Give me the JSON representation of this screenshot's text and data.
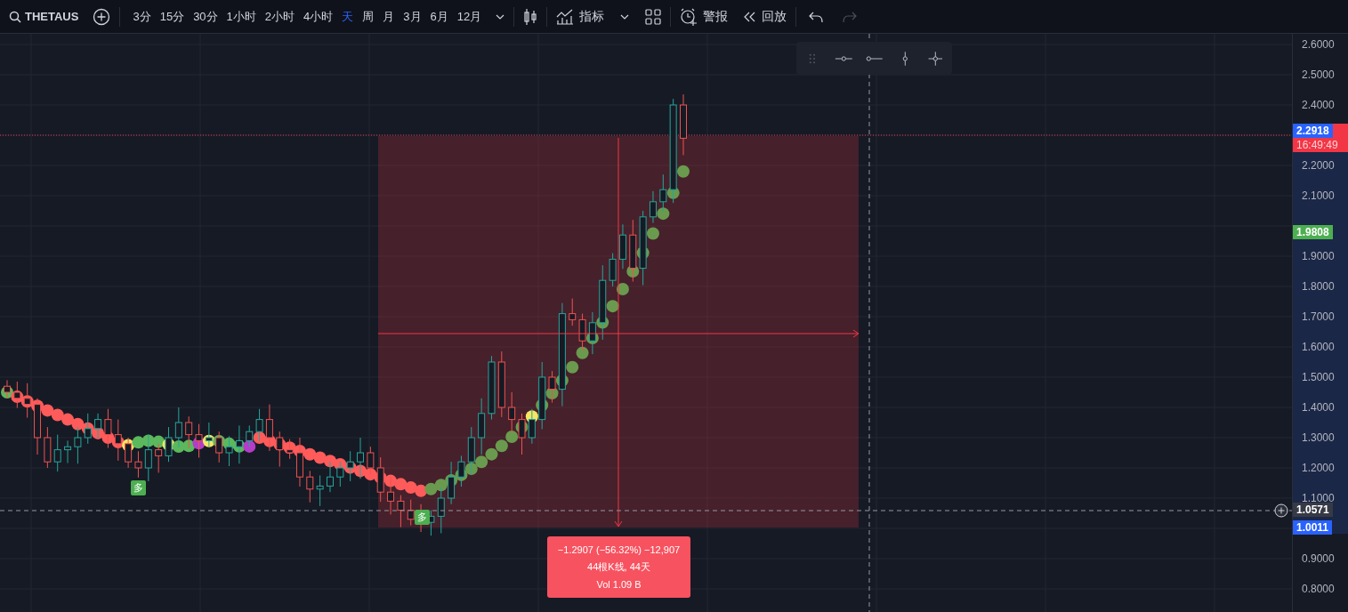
{
  "toolbar": {
    "symbol": "THETAUS",
    "intervals": [
      {
        "label": "3分",
        "selected": false
      },
      {
        "label": "15分",
        "selected": false
      },
      {
        "label": "30分",
        "selected": false
      },
      {
        "label": "1小时",
        "selected": false
      },
      {
        "label": "2小时",
        "selected": false
      },
      {
        "label": "4小时",
        "selected": false
      },
      {
        "label": "天",
        "selected": true
      },
      {
        "label": "周",
        "selected": false
      },
      {
        "label": "月",
        "selected": false
      },
      {
        "label": "3月",
        "selected": false
      },
      {
        "label": "6月",
        "selected": false
      },
      {
        "label": "12月",
        "selected": false
      }
    ],
    "indicators_label": "指标",
    "alert_label": "警报",
    "replay_label": "回放",
    "undo_disabled": false,
    "redo_disabled": true
  },
  "price_axis": {
    "labels": [
      "2.6000",
      "2.5000",
      "2.4000",
      "2.2000",
      "2.1000",
      "1.9000",
      "1.8000",
      "1.7000",
      "1.6000",
      "1.5000",
      "1.4000",
      "1.3000",
      "1.2000",
      "1.1000",
      "0.9000",
      "0.8000"
    ]
  },
  "price_tags": [
    {
      "kind": "last-price",
      "text": "2.2918",
      "countdown": "16:49:49"
    },
    {
      "kind": "indicator",
      "text": "1.9808"
    },
    {
      "kind": "crosshair",
      "text": "1.0571"
    },
    {
      "kind": "low",
      "text": "1.0011"
    }
  ],
  "signals": [
    {
      "text": "多"
    },
    {
      "text": "多"
    }
  ],
  "measure": {
    "change": "−1.2907 (−56.32%) −12,907",
    "bars": "44根K线, 44天",
    "volume": "Vol 1.09 B"
  }
}
